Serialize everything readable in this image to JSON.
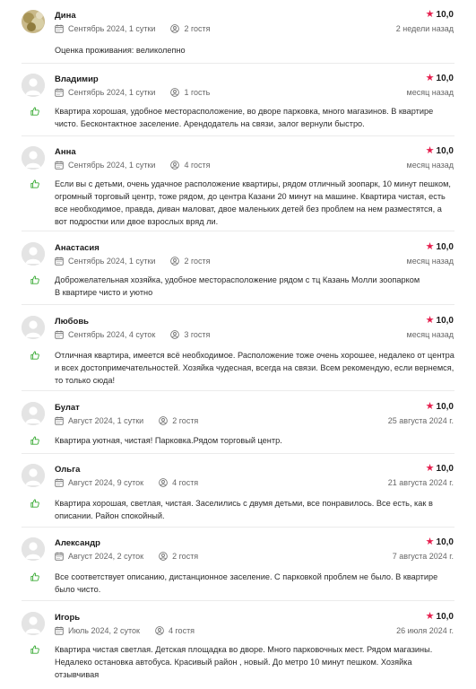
{
  "accent_color": "#e61e4d",
  "icons": {
    "stay": "calendar-icon",
    "guests": "user-circle-icon",
    "like": "thumbs-up-icon",
    "rating": "star-icon"
  },
  "reviews": [
    {
      "name": "Дина",
      "stay": "Сентябрь 2024, 1 сутки",
      "guests": "2 гостя",
      "rating": "10,0",
      "when": "2 недели назад",
      "text": "Оценка проживания: великолепно",
      "photo": true,
      "like": false
    },
    {
      "name": "Владимир",
      "stay": "Сентябрь 2024, 1 сутки",
      "guests": "1 гость",
      "rating": "10,0",
      "when": "месяц назад",
      "text": "Квартира хорошая, удобное месторасположение, во дворе парковка, много магазинов. В квартире чисто. Бесконтактное заселение. Арендодатель на связи, залог вернули быстро.",
      "like": true
    },
    {
      "name": "Анна",
      "stay": "Сентябрь 2024, 1 сутки",
      "guests": "4 гостя",
      "rating": "10,0",
      "when": "месяц назад",
      "text": "Если вы с детьми, очень удачное расположение квартиры, рядом отличный зоопарк, 10 минут пешком, огромный торговый центр, тоже рядом, до центра Казани 20 минут на машине. Квартира чистая, есть все необходимое, правда, диван маловат, двое маленьких детей без проблем на нем разместятся, а вот подростки или двое взрослых вряд ли.",
      "like": true
    },
    {
      "name": "Анастасия",
      "stay": "Сентябрь 2024, 1 сутки",
      "guests": "2 гостя",
      "rating": "10,0",
      "when": "месяц назад",
      "text": "Доброжелательная хозяйка, удобное месторасположение рядом с тц Казань Молли зоопарком\nВ квартире чисто и уютно",
      "like": true
    },
    {
      "name": "Любовь",
      "stay": "Сентябрь 2024, 4 суток",
      "guests": "3 гостя",
      "rating": "10,0",
      "when": "месяц назад",
      "text": "Отличная квартира, имеется всё необходимое. Расположение тоже очень хорошее, недалеко от центра и всех достопримечательностей. Хозяйка чудесная, всегда на связи. Всем рекомендую, если вернемся, то только сюда!",
      "like": true
    },
    {
      "name": "Булат",
      "stay": "Август 2024, 1 сутки",
      "guests": "2 гостя",
      "rating": "10,0",
      "when": "25 августа 2024 г.",
      "text": "Квартира уютная, чистая! Парковка.Рядом торговый центр.",
      "like": true
    },
    {
      "name": "Ольга",
      "stay": "Август 2024, 9 суток",
      "guests": "4 гостя",
      "rating": "10,0",
      "when": "21 августа 2024 г.",
      "text": "Квартира хорошая, светлая, чистая. Заселились с двумя детьми, все понравилось. Все есть, как в описании. Район спокойный.",
      "like": true
    },
    {
      "name": "Александр",
      "stay": "Август 2024, 2 суток",
      "guests": "2 гостя",
      "rating": "10,0",
      "when": "7 августа 2024 г.",
      "text": "Все соответствует описанию, дистанционное заселение. С парковкой проблем не было. В квартире было чисто.",
      "like": true
    },
    {
      "name": "Игорь",
      "stay": "Июль 2024, 2 суток",
      "guests": "4 гостя",
      "rating": "10,0",
      "when": "26 июля 2024 г.",
      "text": "Квартира чистая светлая. Детская площадка во дворе. Много парковочных мест. Рядом магазины. Недалеко остановка автобуса. Красивый район , новый. До метро 10 минут пешком. Хозяйка отзывчивая",
      "like": true
    }
  ]
}
